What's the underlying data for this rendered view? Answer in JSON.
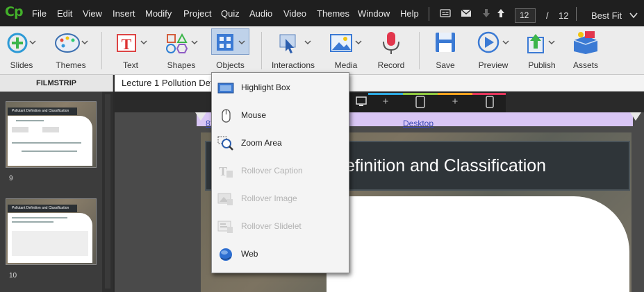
{
  "app": {
    "logo": "Cp"
  },
  "menu": {
    "items": [
      "File",
      "Edit",
      "View",
      "Insert",
      "Modify",
      "Project",
      "Quiz",
      "Audio",
      "Video",
      "Themes",
      "Window",
      "Help"
    ]
  },
  "pager": {
    "current": "12",
    "separator": "/",
    "total": "12",
    "zoom": "Best Fit"
  },
  "ribbon": {
    "slides": "Slides",
    "themes": "Themes",
    "text": "Text",
    "shapes": "Shapes",
    "objects": "Objects",
    "interactions": "Interactions",
    "media": "Media",
    "record": "Record",
    "save": "Save",
    "preview": "Preview",
    "publish": "Publish",
    "assets": "Assets"
  },
  "filmstrip": {
    "header": "FILMSTRIP",
    "slides": [
      {
        "number": "9",
        "title": "Pollutant Definition and Classification"
      },
      {
        "number": "10",
        "title": "Pollutant Definition and Classification"
      }
    ]
  },
  "stage": {
    "tab_title": "Lecture 1 Pollution Def",
    "breakpoint_label": "Desktop",
    "breakpoint_width": "82",
    "slide_title": "efinition and Classification"
  },
  "objects_menu": {
    "items": [
      {
        "label": "Highlight Box",
        "icon": "highlight-box-icon",
        "enabled": true
      },
      {
        "label": "Mouse",
        "icon": "mouse-icon",
        "enabled": true
      },
      {
        "label": "Zoom Area",
        "icon": "zoom-area-icon",
        "enabled": true
      },
      {
        "label": "Rollover Caption",
        "icon": "rollover-caption-icon",
        "enabled": false
      },
      {
        "label": "Rollover Image",
        "icon": "rollover-image-icon",
        "enabled": false
      },
      {
        "label": "Rollover Slidelet",
        "icon": "rollover-slidelet-icon",
        "enabled": false
      },
      {
        "label": "Web",
        "icon": "web-icon",
        "enabled": true
      }
    ]
  },
  "colors": {
    "accent": "#43b02a",
    "menubar": "#1f1f1f",
    "ribbon": "#ececec",
    "breakpoint": "#d9c6f5",
    "title_bar": "#2f3539",
    "active_tool": "#bfd2ea"
  }
}
